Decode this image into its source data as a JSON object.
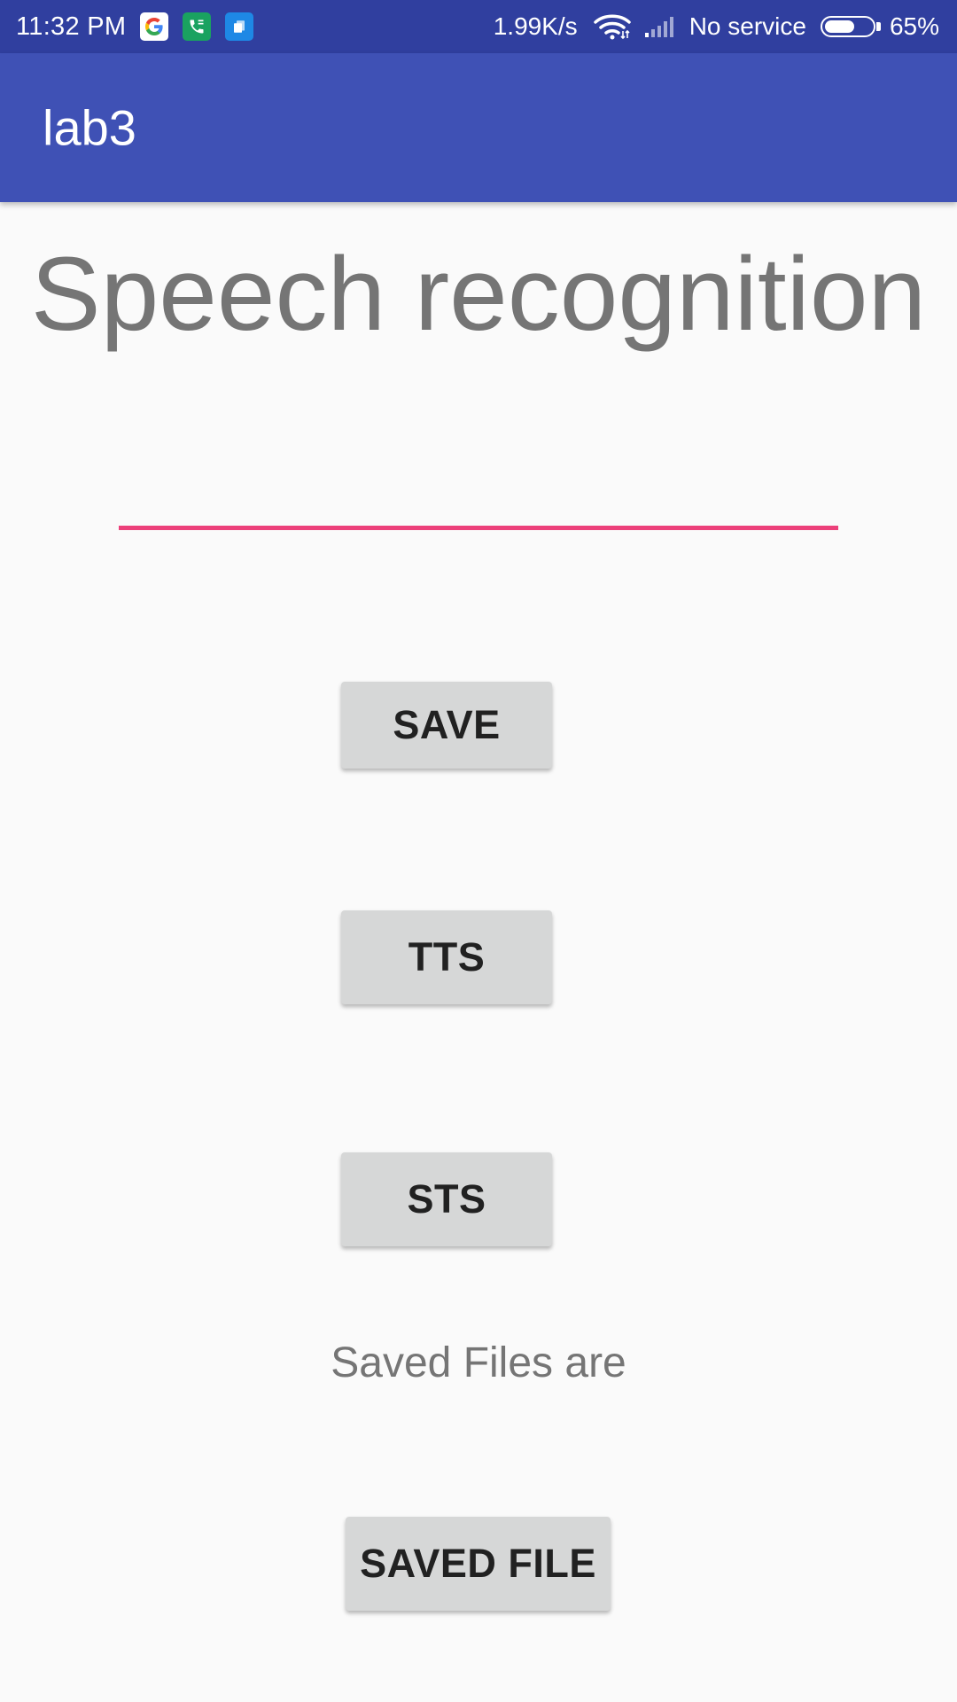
{
  "status_bar": {
    "time": "11:32 PM",
    "notification_icons": [
      "google-icon",
      "phone-icon",
      "files-icon"
    ],
    "network_speed": "1.99K/s",
    "service": "No service",
    "battery_percent_text": "65%",
    "battery_level": 0.65
  },
  "app_bar": {
    "title": "lab3"
  },
  "main": {
    "heading": "Speech recognition",
    "text_input": {
      "value": "",
      "placeholder": ""
    },
    "save_button": "SAVE",
    "tts_button": "TTS",
    "sts_button": "STS",
    "saved_files_label": "Saved Files are",
    "saved_file_button": "SAVED FILE"
  },
  "colors": {
    "status_bar": "#303f9f",
    "app_bar": "#3f51b5",
    "accent": "#ec407a",
    "background": "#fafafa",
    "button": "#d6d7d7"
  }
}
